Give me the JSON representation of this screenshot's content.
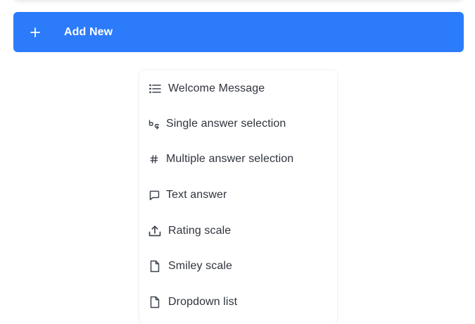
{
  "toolbar": {
    "add_new_label": "Add New"
  },
  "menu": {
    "items": [
      {
        "label": "Welcome Message",
        "icon": "list-icon"
      },
      {
        "label": "Single answer selection",
        "icon": "single-select-icon"
      },
      {
        "label": "Multiple answer selection",
        "icon": "hash-icon"
      },
      {
        "label": "Text answer",
        "icon": "message-square-icon"
      },
      {
        "label": "Rating scale",
        "icon": "upload-icon"
      },
      {
        "label": "Smiley scale",
        "icon": "file-icon"
      },
      {
        "label": "Dropdown list",
        "icon": "file-icon"
      }
    ]
  },
  "colors": {
    "accent": "#2b7bfb",
    "text": "#2f343c",
    "icon": "#3f4550"
  }
}
